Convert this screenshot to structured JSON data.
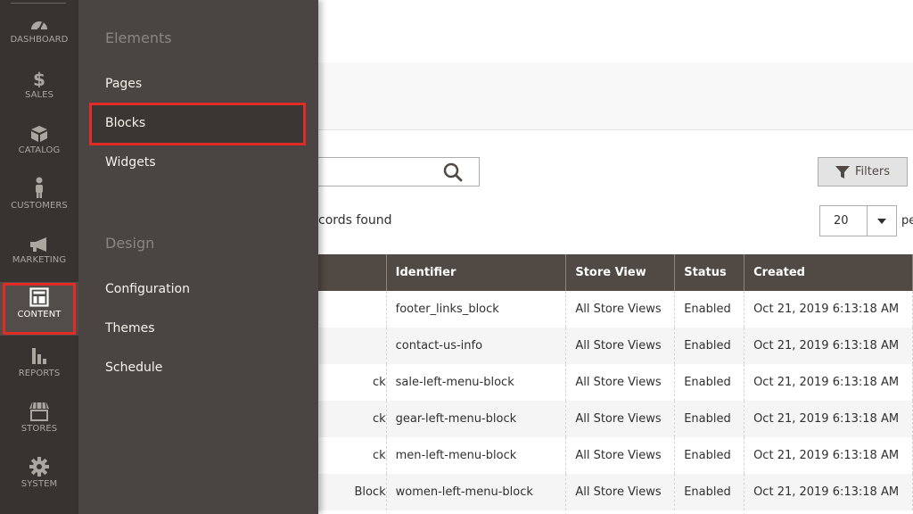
{
  "sidebar": {
    "items": [
      {
        "label": "DASHBOARD",
        "icon": "dashboard-icon"
      },
      {
        "label": "SALES",
        "icon": "dollar-icon"
      },
      {
        "label": "CATALOG",
        "icon": "box-icon"
      },
      {
        "label": "CUSTOMERS",
        "icon": "person-icon"
      },
      {
        "label": "MARKETING",
        "icon": "megaphone-icon"
      },
      {
        "label": "CONTENT",
        "icon": "layout-icon"
      },
      {
        "label": "REPORTS",
        "icon": "bar-chart-icon"
      },
      {
        "label": "STORES",
        "icon": "storefront-icon"
      },
      {
        "label": "SYSTEM",
        "icon": "gear-icon"
      }
    ],
    "active": "CONTENT"
  },
  "submenu": {
    "sections": [
      {
        "title": "Elements",
        "items": [
          "Pages",
          "Blocks",
          "Widgets"
        ]
      },
      {
        "title": "Design",
        "items": [
          "Configuration",
          "Themes",
          "Schedule"
        ]
      }
    ],
    "highlighted": "Blocks"
  },
  "toolbar": {
    "search_value": "",
    "filters_label": "Filters",
    "records_text": "cords found",
    "per_page_value": "20",
    "per_page_label": "pe"
  },
  "grid": {
    "columns": [
      "",
      "Identifier",
      "Store View",
      "Status",
      "Created"
    ],
    "rows": [
      {
        "title": "",
        "identifier": "footer_links_block",
        "store_view": "All Store Views",
        "status": "Enabled",
        "created": "Oct 21, 2019 6:13:18 AM"
      },
      {
        "title": "",
        "identifier": "contact-us-info",
        "store_view": "All Store Views",
        "status": "Enabled",
        "created": "Oct 21, 2019 6:13:18 AM"
      },
      {
        "title": "ck",
        "identifier": "sale-left-menu-block",
        "store_view": "All Store Views",
        "status": "Enabled",
        "created": "Oct 21, 2019 6:13:18 AM"
      },
      {
        "title": "ck",
        "identifier": "gear-left-menu-block",
        "store_view": "All Store Views",
        "status": "Enabled",
        "created": "Oct 21, 2019 6:13:18 AM"
      },
      {
        "title": "ck",
        "identifier": "men-left-menu-block",
        "store_view": "All Store Views",
        "status": "Enabled",
        "created": "Oct 21, 2019 6:13:18 AM"
      },
      {
        "title": "Block",
        "identifier": "women-left-menu-block",
        "store_view": "All Store Views",
        "status": "Enabled",
        "created": "Oct 21, 2019 6:13:18 AM"
      }
    ]
  },
  "colors": {
    "sidebar_bg": "#373330",
    "submenu_bg": "#4a4542",
    "highlight_border": "#e02b27",
    "grid_header_bg": "#514943"
  }
}
